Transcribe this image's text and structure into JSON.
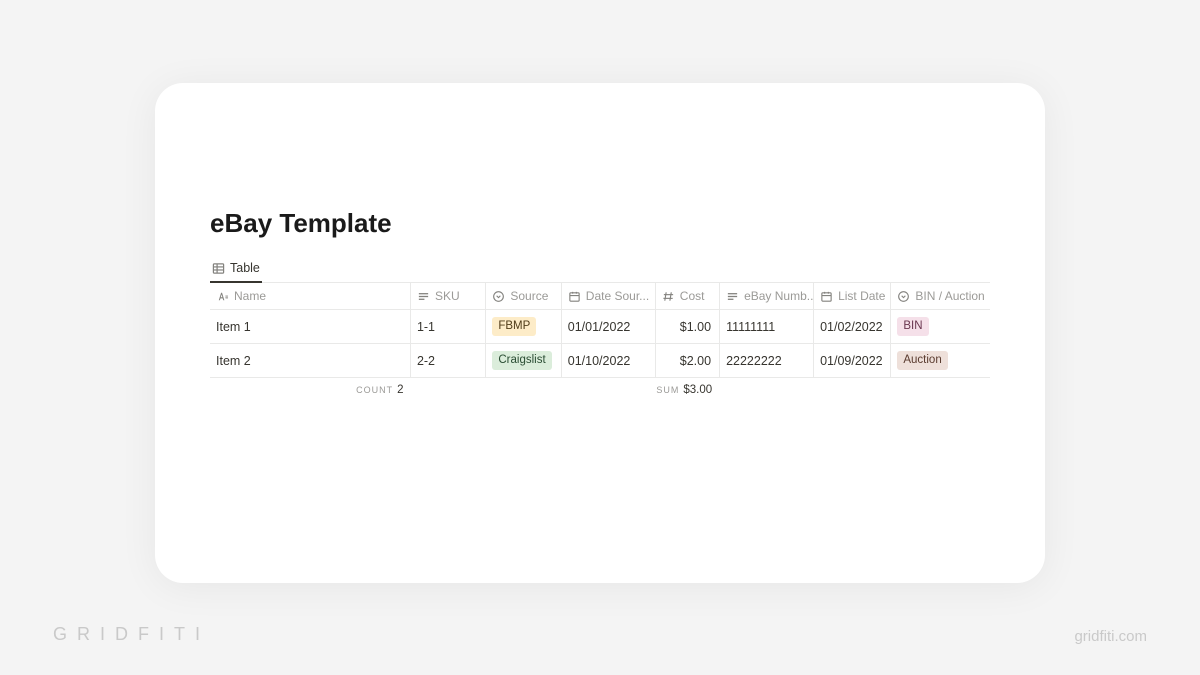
{
  "title": "eBay Template",
  "tab": {
    "label": "Table"
  },
  "columns": {
    "name": "Name",
    "sku": "SKU",
    "source": "Source",
    "date_sourced": "Date Sour...",
    "cost": "Cost",
    "ebay_number": "eBay Numb...",
    "list_date": "List Date",
    "bin_auction": "BIN / Auction"
  },
  "rows": [
    {
      "name": "Item 1",
      "sku": "1-1",
      "source": {
        "label": "FBMP",
        "color": "yellow"
      },
      "date_sourced": "01/01/2022",
      "cost": "$1.00",
      "ebay_number": "11111111",
      "list_date": "01/02/2022",
      "bin_auction": {
        "label": "BIN",
        "color": "pink"
      }
    },
    {
      "name": "Item 2",
      "sku": "2-2",
      "source": {
        "label": "Craigslist",
        "color": "green"
      },
      "date_sourced": "01/10/2022",
      "cost": "$2.00",
      "ebay_number": "22222222",
      "list_date": "01/09/2022",
      "bin_auction": {
        "label": "Auction",
        "color": "brown"
      }
    }
  ],
  "summary": {
    "count": {
      "label": "COUNT",
      "value": "2"
    },
    "sum": {
      "label": "SUM",
      "value": "$3.00"
    }
  },
  "watermark": {
    "left": "GRIDFITI",
    "right": "gridfiti.com"
  },
  "chart_data": {
    "type": "table",
    "title": "eBay Template",
    "columns": [
      "Name",
      "SKU",
      "Source",
      "Date Sourced",
      "Cost",
      "eBay Number",
      "List Date",
      "BIN / Auction"
    ],
    "rows": [
      [
        "Item 1",
        "1-1",
        "FBMP",
        "01/01/2022",
        1.0,
        "11111111",
        "01/02/2022",
        "BIN"
      ],
      [
        "Item 2",
        "2-2",
        "Craigslist",
        "01/10/2022",
        2.0,
        "22222222",
        "01/09/2022",
        "Auction"
      ]
    ],
    "aggregates": {
      "count_name": 2,
      "sum_cost": 3.0
    }
  }
}
